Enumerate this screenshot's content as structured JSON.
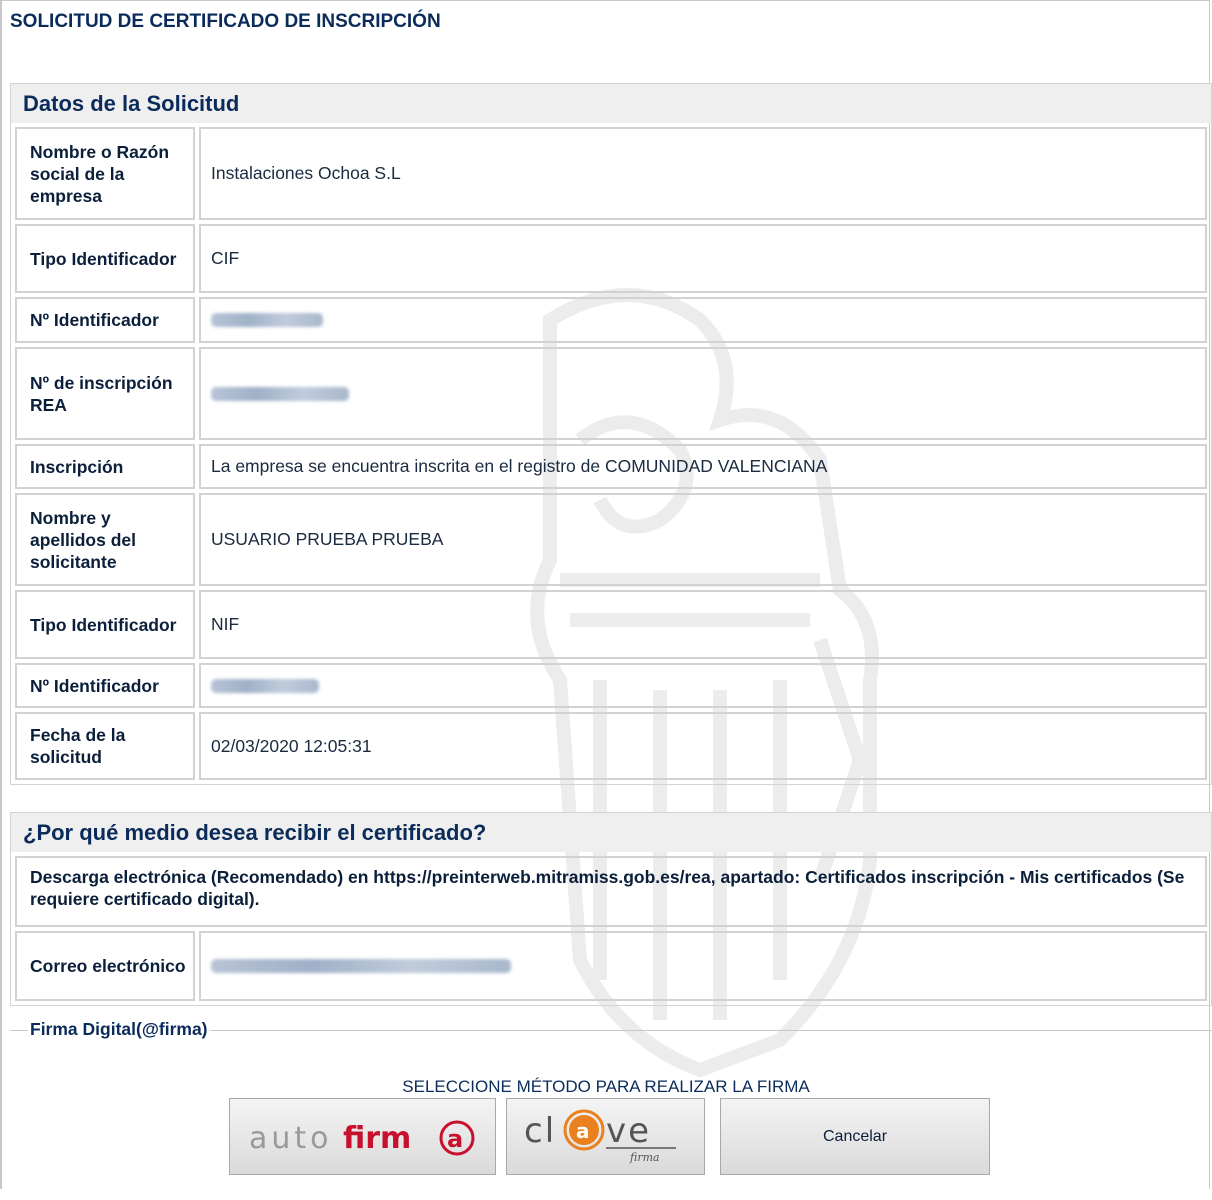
{
  "page_title": "SOLICITUD DE CERTIFICADO DE INSCRIPCIÓN",
  "datos": {
    "header": "Datos de la Solicitud",
    "rows": [
      {
        "label": "Nombre o Razón social de la empresa",
        "value": "Instalaciones Ochoa S.L",
        "blurred": false
      },
      {
        "label": "Tipo Identificador",
        "value": "CIF",
        "blurred": false
      },
      {
        "label": "Nº Identificador",
        "value": "",
        "blurred": true
      },
      {
        "label": "Nº de inscripción REA",
        "value": "",
        "blurred": true
      },
      {
        "label": "Inscripción",
        "value": "La empresa se encuentra inscrita en el registro de COMUNIDAD VALENCIANA",
        "blurred": false
      },
      {
        "label": "Nombre y apellidos del solicitante",
        "value": "USUARIO PRUEBA PRUEBA",
        "blurred": false
      },
      {
        "label": "Tipo Identificador",
        "value": "NIF",
        "blurred": false
      },
      {
        "label": "Nº Identificador",
        "value": "",
        "blurred": true
      },
      {
        "label": "Fecha de la solicitud",
        "value": "02/03/2020 12:05:31",
        "blurred": false
      }
    ]
  },
  "medio": {
    "header": "¿Por qué medio desea recibir el certificado?",
    "descarga_text": "Descarga electrónica (Recomendado) en https://preinterweb.mitramiss.gob.es/rea, apartado: Certificados inscripción - Mis certificados (Se requiere certificado digital).",
    "correo_label": "Correo electrónico",
    "correo_value": ""
  },
  "firma": {
    "legend": "Firma Digital(@firma)",
    "method_label": "SELECCIONE MÉTODO PARA REALIZAR LA FIRMA",
    "autofirma_logo": "autofirm@",
    "clave_logo": "cl@ve firma",
    "cancel_label": "Cancelar"
  },
  "colors": {
    "heading": "#0b2b5a",
    "header_bg": "#efefef",
    "border": "#d2d2d2",
    "autofirma_red": "#c8102e"
  }
}
